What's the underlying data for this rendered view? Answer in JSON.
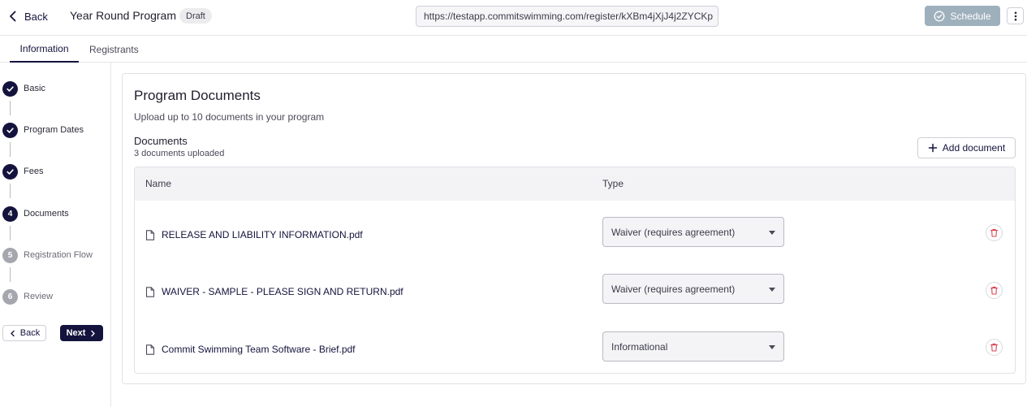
{
  "header": {
    "back_label": "Back",
    "program_title": "Year Round Program",
    "status_badge": "Draft",
    "registration_url": "https://testapp.commitswimming.com/register/kXBm4jXjJ4j2ZYCKp",
    "schedule_label": "Schedule"
  },
  "tabs": [
    {
      "label": "Information",
      "active": true
    },
    {
      "label": "Registrants",
      "active": false
    }
  ],
  "stepper": {
    "steps": [
      {
        "number": "1",
        "label": "Basic",
        "state": "done"
      },
      {
        "number": "2",
        "label": "Program Dates",
        "state": "done"
      },
      {
        "number": "3",
        "label": "Fees",
        "state": "done"
      },
      {
        "number": "4",
        "label": "Documents",
        "state": "current"
      },
      {
        "number": "5",
        "label": "Registration Flow",
        "state": "todo"
      },
      {
        "number": "6",
        "label": "Review",
        "state": "todo"
      }
    ],
    "back_label": "Back",
    "next_label": "Next"
  },
  "documents_card": {
    "title": "Program Documents",
    "subtitle": "Upload up to 10 documents in your program",
    "section_label": "Documents",
    "count_text": "3 documents uploaded",
    "add_label": "Add document",
    "columns": {
      "name": "Name",
      "type": "Type"
    },
    "rows": [
      {
        "file_name": "RELEASE AND LIABILITY INFORMATION.pdf",
        "type": "Waiver (requires agreement)"
      },
      {
        "file_name": "WAIVER - SAMPLE - PLEASE SIGN AND RETURN.pdf",
        "type": "Waiver (requires agreement)"
      },
      {
        "file_name": "Commit Swimming Team Software - Brief.pdf",
        "type": "Informational"
      }
    ]
  },
  "colors": {
    "primary": "#14133d",
    "schedule_disabled": "#9fb0bd",
    "step_todo": "#a6a7ae",
    "delete": "#d94452"
  }
}
